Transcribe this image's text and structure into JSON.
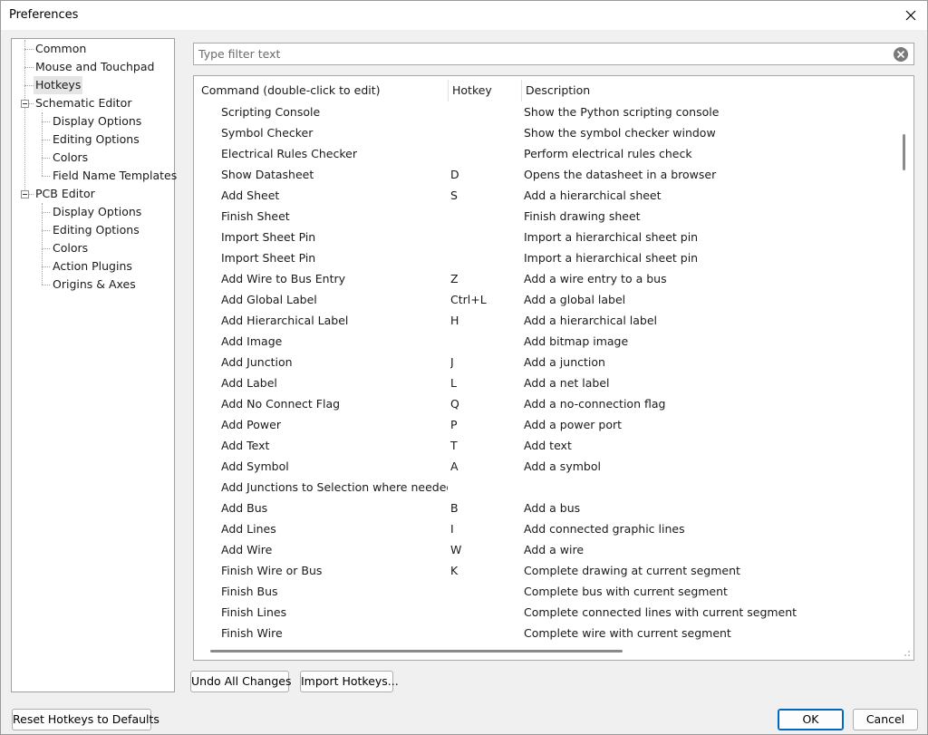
{
  "window": {
    "title": "Preferences"
  },
  "tree": {
    "items": [
      {
        "label": "Common",
        "level": 0,
        "selected": false
      },
      {
        "label": "Mouse and Touchpad",
        "level": 0,
        "selected": false
      },
      {
        "label": "Hotkeys",
        "level": 0,
        "selected": true
      },
      {
        "label": "Schematic Editor",
        "level": 0,
        "expanded": true
      },
      {
        "label": "Display Options",
        "level": 1
      },
      {
        "label": "Editing Options",
        "level": 1
      },
      {
        "label": "Colors",
        "level": 1
      },
      {
        "label": "Field Name Templates",
        "level": 1
      },
      {
        "label": "PCB Editor",
        "level": 0,
        "expanded": true
      },
      {
        "label": "Display Options",
        "level": 1
      },
      {
        "label": "Editing Options",
        "level": 1
      },
      {
        "label": "Colors",
        "level": 1
      },
      {
        "label": "Action Plugins",
        "level": 1
      },
      {
        "label": "Origins & Axes",
        "level": 1
      }
    ]
  },
  "filter": {
    "placeholder": "Type filter text",
    "value": "",
    "clear_icon": "clear-circle-x-icon"
  },
  "grid": {
    "columns": [
      "Command (double-click to edit)",
      "Hotkey",
      "Description"
    ],
    "rows": [
      {
        "command": "Scripting Console",
        "hotkey": "",
        "description": "Show the Python scripting console"
      },
      {
        "command": "Symbol Checker",
        "hotkey": "",
        "description": "Show the symbol checker window"
      },
      {
        "command": "Electrical Rules Checker",
        "hotkey": "",
        "description": "Perform electrical rules check"
      },
      {
        "command": "Show Datasheet",
        "hotkey": "D",
        "description": "Opens the datasheet in a browser"
      },
      {
        "command": "Add Sheet",
        "hotkey": "S",
        "description": "Add a hierarchical sheet"
      },
      {
        "command": "Finish Sheet",
        "hotkey": "",
        "description": "Finish drawing sheet"
      },
      {
        "command": "Import Sheet Pin",
        "hotkey": "",
        "description": "Import a hierarchical sheet pin"
      },
      {
        "command": "Import Sheet Pin",
        "hotkey": "",
        "description": "Import a hierarchical sheet pin"
      },
      {
        "command": "Add Wire to Bus Entry",
        "hotkey": "Z",
        "description": "Add a wire entry to a bus"
      },
      {
        "command": "Add Global Label",
        "hotkey": "Ctrl+L",
        "description": "Add a global label"
      },
      {
        "command": "Add Hierarchical Label",
        "hotkey": "H",
        "description": "Add a hierarchical label"
      },
      {
        "command": "Add Image",
        "hotkey": "",
        "description": "Add bitmap image"
      },
      {
        "command": "Add Junction",
        "hotkey": "J",
        "description": "Add a junction"
      },
      {
        "command": "Add Label",
        "hotkey": "L",
        "description": "Add a net label"
      },
      {
        "command": "Add No Connect Flag",
        "hotkey": "Q",
        "description": "Add a no-connection flag"
      },
      {
        "command": "Add Power",
        "hotkey": "P",
        "description": "Add a power port"
      },
      {
        "command": "Add Text",
        "hotkey": "T",
        "description": "Add text"
      },
      {
        "command": "Add Symbol",
        "hotkey": "A",
        "description": "Add a symbol"
      },
      {
        "command": "Add Junctions to Selection where needed",
        "hotkey": "",
        "description": ""
      },
      {
        "command": "Add Bus",
        "hotkey": "B",
        "description": "Add a bus"
      },
      {
        "command": "Add Lines",
        "hotkey": "I",
        "description": "Add connected graphic lines"
      },
      {
        "command": "Add Wire",
        "hotkey": "W",
        "description": "Add a wire"
      },
      {
        "command": "Finish Wire or Bus",
        "hotkey": "K",
        "description": "Complete drawing at current segment"
      },
      {
        "command": "Finish Bus",
        "hotkey": "",
        "description": "Complete bus with current segment"
      },
      {
        "command": "Finish Lines",
        "hotkey": "",
        "description": "Complete connected lines with current segment"
      },
      {
        "command": "Finish Wire",
        "hotkey": "",
        "description": "Complete wire with current segment"
      }
    ]
  },
  "buttons": {
    "undo_all": "Undo All Changes",
    "import_hotkeys": "Import Hotkeys...",
    "reset_defaults": "Reset Hotkeys to Defaults",
    "ok": "OK",
    "cancel": "Cancel"
  },
  "colors": {
    "accent": "#0067c0",
    "selected_bg": "#e5e5e5"
  }
}
